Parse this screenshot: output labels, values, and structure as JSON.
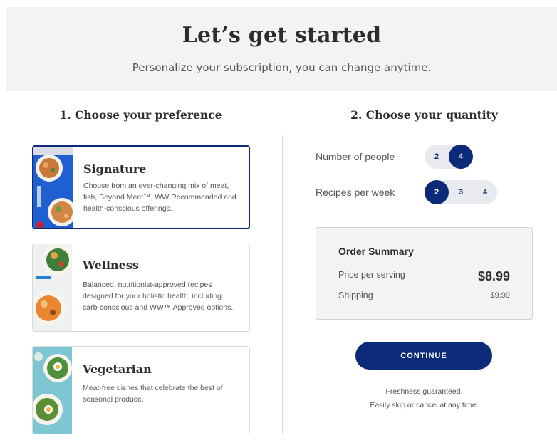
{
  "hero": {
    "title": "Let’s get started",
    "subtitle": "Personalize your subscription, you can change anytime."
  },
  "preference": {
    "heading": "1. Choose your preference",
    "plans": [
      {
        "title": "Signature",
        "description": "Choose from an ever-changing mix of meat, fish, Beyond Meat™, WW Recommended and health-conscious offerings.",
        "selected": true
      },
      {
        "title": "Wellness",
        "description": "Balanced, nutritionist-approved recipes designed for your holistic health, including carb-conscious and WW™ Approved options.",
        "selected": false
      },
      {
        "title": "Vegetarian",
        "description": "Meat-free dishes that celebrate the best of seasonal produce.",
        "selected": false
      }
    ]
  },
  "quantity": {
    "heading": "2. Choose your quantity",
    "people": {
      "label": "Number of people",
      "options": [
        "2",
        "4"
      ],
      "selected": "4"
    },
    "recipes": {
      "label": "Recipes per week",
      "options": [
        "2",
        "3",
        "4"
      ],
      "selected": "2"
    }
  },
  "summary": {
    "title": "Order Summary",
    "price_label": "Price per serving",
    "price_value": "$8.99",
    "shipping_label": "Shipping",
    "shipping_value": "$9.99"
  },
  "cta": {
    "continue_label": "CONTINUE"
  },
  "notes": {
    "line1": "Freshness guaranteed.",
    "line2": "Easily skip or cancel at any time."
  },
  "colors": {
    "brand": "#0b2a78",
    "hero_bg": "#f2f3f5",
    "pill_bg": "#e9eaef"
  }
}
